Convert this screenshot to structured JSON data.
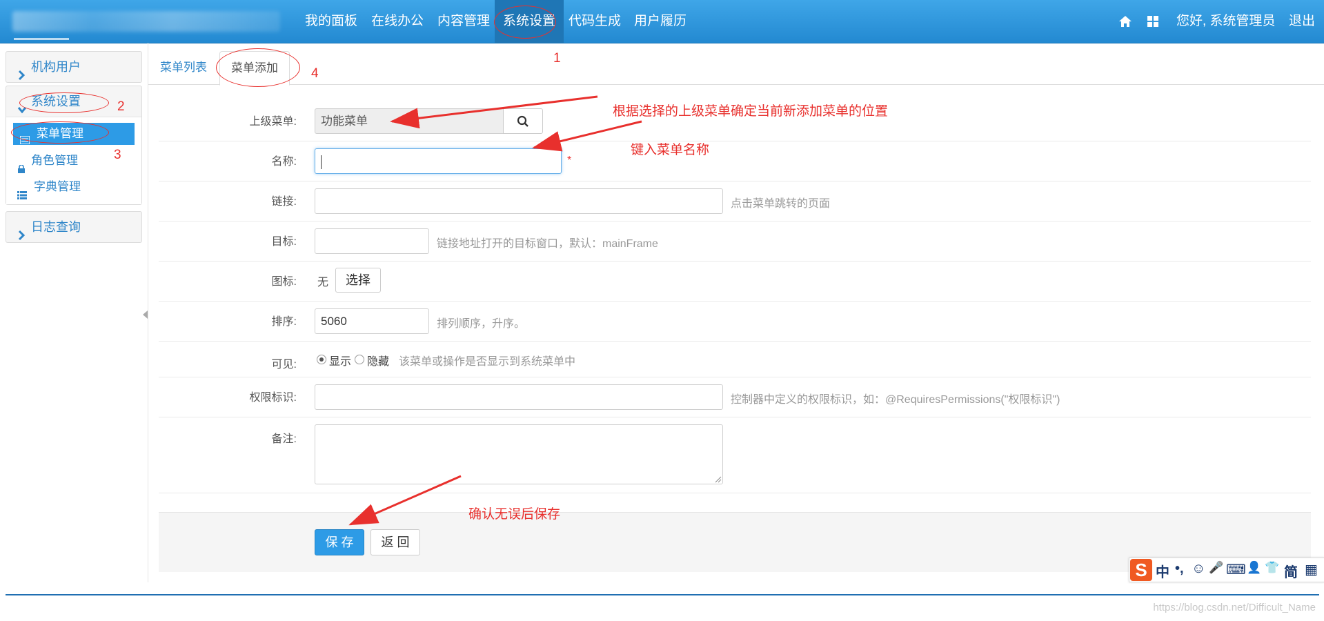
{
  "navbar": {
    "items": [
      "我的面板",
      "在线办公",
      "内容管理",
      "系统设置",
      "代码生成",
      "用户履历"
    ],
    "active_index": 3,
    "greeting": "您好, 系统管理员",
    "logout": "退出",
    "icons": [
      "home-icon",
      "grid-icon"
    ]
  },
  "sidebar": {
    "groups": [
      {
        "label": "机构用户",
        "expanded": false
      },
      {
        "label": "系统设置",
        "expanded": true,
        "items": [
          {
            "label": "菜单管理",
            "icon": "list-icon",
            "active": true
          },
          {
            "label": "角色管理",
            "icon": "lock-icon",
            "active": false
          },
          {
            "label": "字典管理",
            "icon": "table-icon",
            "active": false
          }
        ]
      },
      {
        "label": "日志查询",
        "expanded": false
      }
    ]
  },
  "tabs": {
    "list": "菜单列表",
    "add": "菜单添加"
  },
  "form": {
    "parent": {
      "label": "上级菜单:",
      "value": "功能菜单"
    },
    "name": {
      "label": "名称:",
      "value": "",
      "required_mark": "*"
    },
    "href": {
      "label": "链接:",
      "value": "",
      "help": "点击菜单跳转的页面"
    },
    "target": {
      "label": "目标:",
      "value": "",
      "help": "链接地址打开的目标窗口，默认：mainFrame"
    },
    "icon": {
      "label": "图标:",
      "value": "无",
      "button": "选择"
    },
    "sort": {
      "label": "排序:",
      "value": "5060",
      "help": "排列顺序，升序。"
    },
    "visible": {
      "label": "可见:",
      "options": [
        "显示",
        "隐藏"
      ],
      "selected": "显示",
      "help": "该菜单或操作是否显示到系统菜单中"
    },
    "permission": {
      "label": "权限标识:",
      "value": "",
      "help": "控制器中定义的权限标识，如：@RequiresPermissions(\"权限标识\")"
    },
    "remarks": {
      "label": "备注:",
      "value": ""
    },
    "save": "保 存",
    "back": "返 回"
  },
  "annotations": {
    "n1": "1",
    "n2": "2",
    "n3": "3",
    "n4": "4",
    "parent_note": "根据选择的上级菜单确定当前新添加菜单的位置",
    "name_note": "键入菜单名称",
    "save_note": "确认无误后保存",
    "color": "#e8302d"
  },
  "ime_bar": {
    "items": [
      "中",
      "•,",
      "☺",
      "🎤",
      "⌨",
      "👤",
      "👕",
      "简",
      "▦"
    ]
  },
  "watermark": "https://blog.csdn.net/Difficult_Name",
  "colors": {
    "nav": "#2389d1",
    "accent": "#2d9be6",
    "link": "#2f86c9"
  }
}
